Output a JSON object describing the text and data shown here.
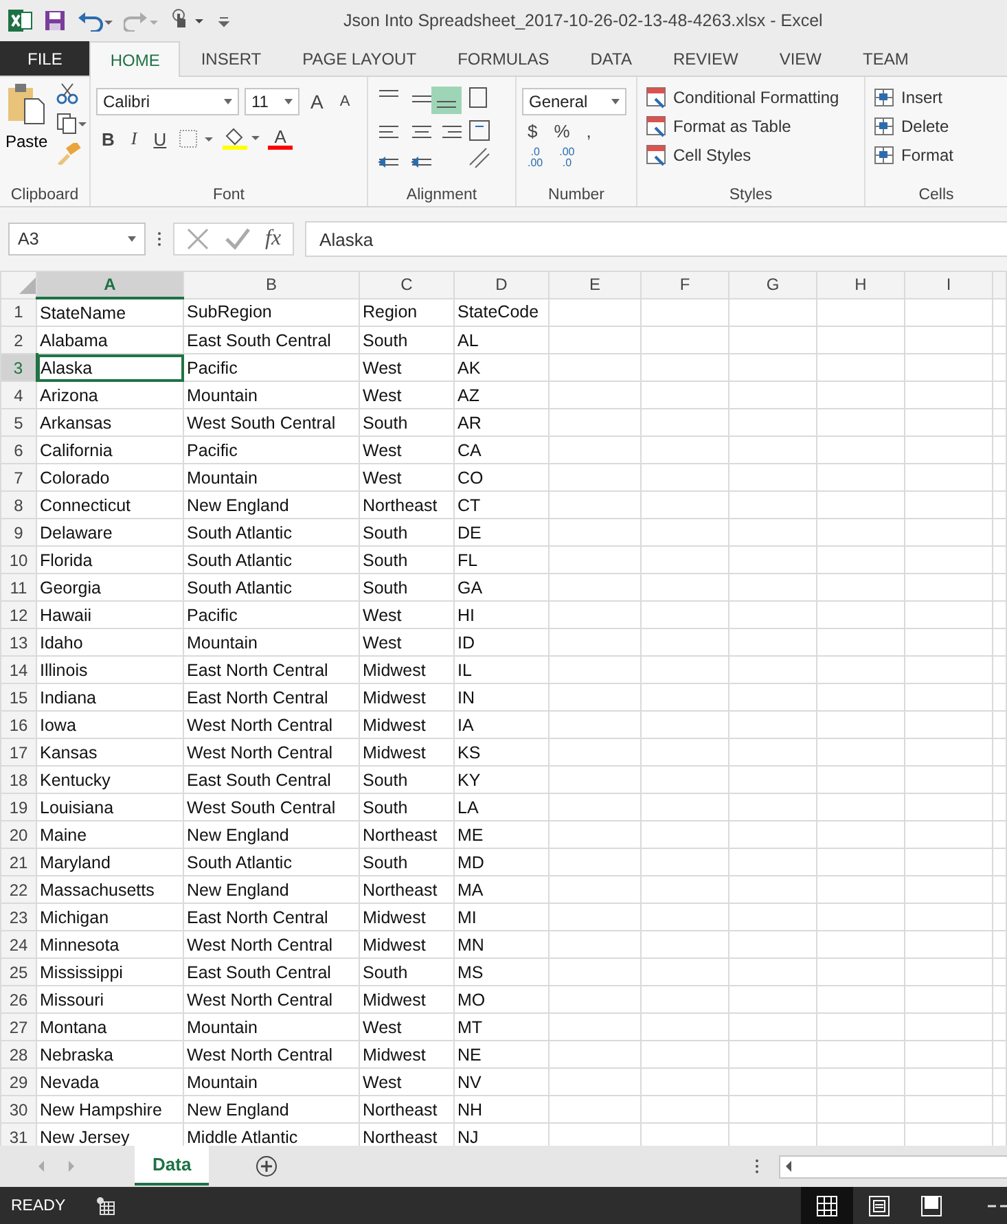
{
  "window": {
    "title": "Json Into Spreadsheet_2017-10-26-02-13-48-4263.xlsx - Excel"
  },
  "ribbon_tabs": [
    {
      "label": "FILE",
      "kind": "file",
      "selected": false
    },
    {
      "label": "HOME",
      "kind": "tab",
      "selected": true
    },
    {
      "label": "INSERT",
      "kind": "tab",
      "selected": false
    },
    {
      "label": "PAGE LAYOUT",
      "kind": "tab",
      "selected": false
    },
    {
      "label": "FORMULAS",
      "kind": "tab",
      "selected": false
    },
    {
      "label": "DATA",
      "kind": "tab",
      "selected": false
    },
    {
      "label": "REVIEW",
      "kind": "tab",
      "selected": false
    },
    {
      "label": "VIEW",
      "kind": "tab",
      "selected": false
    },
    {
      "label": "TEAM",
      "kind": "tab",
      "selected": false
    }
  ],
  "ribbon": {
    "clipboard": {
      "label": "Clipboard",
      "paste": "Paste"
    },
    "font": {
      "label": "Font",
      "family": "Calibri",
      "size": "11",
      "grow": "A",
      "shrink": "A",
      "bold": "B",
      "italic": "I",
      "underline": "U",
      "font_color": "A"
    },
    "alignment": {
      "label": "Alignment"
    },
    "number": {
      "label": "Number",
      "format": "General",
      "currency": "$",
      "percent": "%",
      "comma": ",",
      "increase_decimal": [
        ".0",
        ".00"
      ],
      "decrease_decimal": [
        ".00",
        ".0"
      ]
    },
    "styles": {
      "label": "Styles",
      "items": [
        "Conditional Formatting",
        "Format as Table",
        "Cell Styles"
      ]
    },
    "cells": {
      "label": "Cells",
      "items": [
        "Insert",
        "Delete",
        "Format"
      ]
    }
  },
  "formula_bar": {
    "name_box": "A3",
    "fx": "fx",
    "value": "Alaska"
  },
  "columns": [
    {
      "label": "A",
      "selected": true
    },
    {
      "label": "B",
      "selected": false
    },
    {
      "label": "C",
      "selected": false
    },
    {
      "label": "D",
      "selected": false
    },
    {
      "label": "E",
      "selected": false
    },
    {
      "label": "F",
      "selected": false
    },
    {
      "label": "G",
      "selected": false
    },
    {
      "label": "H",
      "selected": false
    },
    {
      "label": "I",
      "selected": false
    }
  ],
  "rows": [
    {
      "number": "1",
      "selected": false,
      "cells": [
        "StateName",
        "SubRegion",
        "Region",
        "StateCode"
      ]
    },
    {
      "number": "2",
      "selected": false,
      "cells": [
        "Alabama",
        "East South Central",
        "South",
        "AL"
      ]
    },
    {
      "number": "3",
      "selected": true,
      "cells": [
        "Alaska",
        "Pacific",
        "West",
        "AK"
      ]
    },
    {
      "number": "4",
      "selected": false,
      "cells": [
        "Arizona",
        "Mountain",
        "West",
        "AZ"
      ]
    },
    {
      "number": "5",
      "selected": false,
      "cells": [
        "Arkansas",
        "West South Central",
        "South",
        "AR"
      ]
    },
    {
      "number": "6",
      "selected": false,
      "cells": [
        "California",
        "Pacific",
        "West",
        "CA"
      ]
    },
    {
      "number": "7",
      "selected": false,
      "cells": [
        "Colorado",
        "Mountain",
        "West",
        "CO"
      ]
    },
    {
      "number": "8",
      "selected": false,
      "cells": [
        "Connecticut",
        "New England",
        "Northeast",
        "CT"
      ]
    },
    {
      "number": "9",
      "selected": false,
      "cells": [
        "Delaware",
        "South Atlantic",
        "South",
        "DE"
      ]
    },
    {
      "number": "10",
      "selected": false,
      "cells": [
        "Florida",
        "South Atlantic",
        "South",
        "FL"
      ]
    },
    {
      "number": "11",
      "selected": false,
      "cells": [
        "Georgia",
        "South Atlantic",
        "South",
        "GA"
      ]
    },
    {
      "number": "12",
      "selected": false,
      "cells": [
        "Hawaii",
        "Pacific",
        "West",
        "HI"
      ]
    },
    {
      "number": "13",
      "selected": false,
      "cells": [
        "Idaho",
        "Mountain",
        "West",
        "ID"
      ]
    },
    {
      "number": "14",
      "selected": false,
      "cells": [
        "Illinois",
        "East North Central",
        "Midwest",
        "IL"
      ]
    },
    {
      "number": "15",
      "selected": false,
      "cells": [
        "Indiana",
        "East North Central",
        "Midwest",
        "IN"
      ]
    },
    {
      "number": "16",
      "selected": false,
      "cells": [
        "Iowa",
        "West North Central",
        "Midwest",
        "IA"
      ]
    },
    {
      "number": "17",
      "selected": false,
      "cells": [
        "Kansas",
        "West North Central",
        "Midwest",
        "KS"
      ]
    },
    {
      "number": "18",
      "selected": false,
      "cells": [
        "Kentucky",
        "East South Central",
        "South",
        "KY"
      ]
    },
    {
      "number": "19",
      "selected": false,
      "cells": [
        "Louisiana",
        "West South Central",
        "South",
        "LA"
      ]
    },
    {
      "number": "20",
      "selected": false,
      "cells": [
        "Maine",
        "New England",
        "Northeast",
        "ME"
      ]
    },
    {
      "number": "21",
      "selected": false,
      "cells": [
        "Maryland",
        "South Atlantic",
        "South",
        "MD"
      ]
    },
    {
      "number": "22",
      "selected": false,
      "cells": [
        "Massachusetts",
        "New England",
        "Northeast",
        "MA"
      ]
    },
    {
      "number": "23",
      "selected": false,
      "cells": [
        "Michigan",
        "East North Central",
        "Midwest",
        "MI"
      ]
    },
    {
      "number": "24",
      "selected": false,
      "cells": [
        "Minnesota",
        "West North Central",
        "Midwest",
        "MN"
      ]
    },
    {
      "number": "25",
      "selected": false,
      "cells": [
        "Mississippi",
        "East South Central",
        "South",
        "MS"
      ]
    },
    {
      "number": "26",
      "selected": false,
      "cells": [
        "Missouri",
        "West North Central",
        "Midwest",
        "MO"
      ]
    },
    {
      "number": "27",
      "selected": false,
      "cells": [
        "Montana",
        "Mountain",
        "West",
        "MT"
      ]
    },
    {
      "number": "28",
      "selected": false,
      "cells": [
        "Nebraska",
        "West North Central",
        "Midwest",
        "NE"
      ]
    },
    {
      "number": "29",
      "selected": false,
      "cells": [
        "Nevada",
        "Mountain",
        "West",
        "NV"
      ]
    },
    {
      "number": "30",
      "selected": false,
      "cells": [
        "New Hampshire",
        "New England",
        "Northeast",
        "NH"
      ]
    },
    {
      "number": "31",
      "selected": false,
      "cells": [
        "New Jersey",
        "Middle Atlantic",
        "Northeast",
        "NJ"
      ]
    }
  ],
  "sheet_tabs": [
    {
      "label": "Data",
      "selected": true
    }
  ],
  "status_bar": {
    "status": "READY"
  }
}
